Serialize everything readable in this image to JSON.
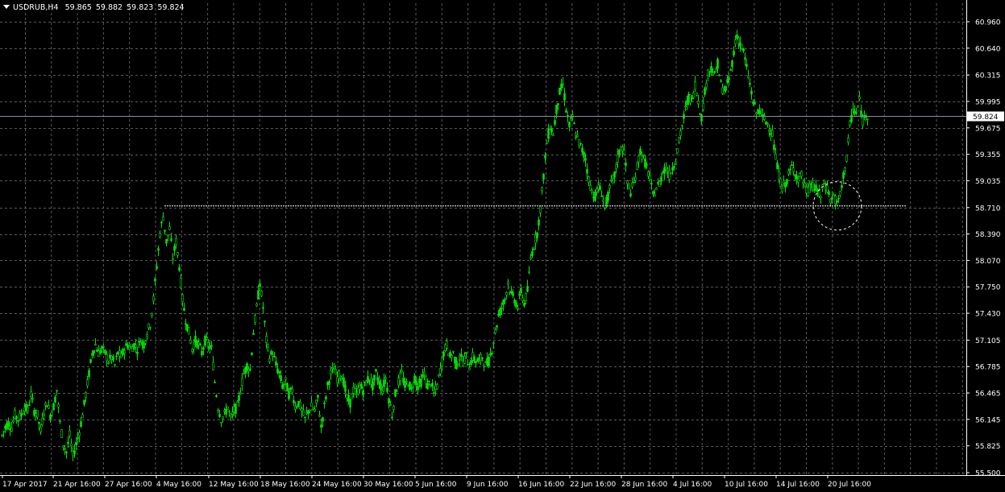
{
  "header": {
    "symbol_timeframe": "USDRUB,H4",
    "open": "59.865",
    "high": "59.882",
    "low": "59.823",
    "close": "59.824"
  },
  "current_price_label": "59.824",
  "colors": {
    "background": "#000000",
    "grid": "#5a5a5a",
    "candle": "#00e600",
    "text": "#ffffff",
    "price_line": "#8a8aa0",
    "level_line": "#ffffff"
  },
  "chart_data": {
    "type": "candlestick",
    "symbol": "USDRUB",
    "timeframe": "H4",
    "y_ticks": [
      "60.960",
      "60.640",
      "60.315",
      "59.995",
      "59.675",
      "59.355",
      "59.035",
      "58.710",
      "58.390",
      "58.070",
      "57.750",
      "57.430",
      "57.105",
      "56.785",
      "56.465",
      "56.145",
      "55.825",
      "55.500"
    ],
    "x_ticks": [
      "17 Apr 2017",
      "21 Apr 16:00",
      "27 Apr 16:00",
      "4 May 16:00",
      "12 May 16:00",
      "18 May 16:00",
      "24 May 16:00",
      "30 May 16:00",
      "5 Jun 16:00",
      "9 Jun 16:00",
      "16 Jun 16:00",
      "22 Jun 16:00",
      "28 Jun 16:00",
      "4 Jul 16:00",
      "10 Jul 16:00",
      "14 Jul 16:00",
      "20 Jul 16:00"
    ],
    "ylim": [
      55.5,
      60.96
    ],
    "grid": true,
    "price_path": [
      [
        0,
        55.95
      ],
      [
        4,
        56.05
      ],
      [
        8,
        56.1
      ],
      [
        12,
        56.05
      ],
      [
        16,
        56.2
      ],
      [
        20,
        56.15
      ],
      [
        24,
        56.2
      ],
      [
        28,
        56.3
      ],
      [
        32,
        56.25
      ],
      [
        36,
        56.45
      ],
      [
        40,
        56.25
      ],
      [
        44,
        56.2
      ],
      [
        48,
        56.0
      ],
      [
        52,
        56.25
      ],
      [
        56,
        56.35
      ],
      [
        60,
        56.2
      ],
      [
        64,
        56.3
      ],
      [
        68,
        56.5
      ],
      [
        72,
        56.1
      ],
      [
        76,
        55.85
      ],
      [
        80,
        55.75
      ],
      [
        84,
        55.95
      ],
      [
        88,
        55.7
      ],
      [
        92,
        55.85
      ],
      [
        96,
        56.0
      ],
      [
        100,
        56.2
      ],
      [
        104,
        56.45
      ],
      [
        108,
        56.7
      ],
      [
        112,
        56.95
      ],
      [
        116,
        57.05
      ],
      [
        120,
        56.95
      ],
      [
        124,
        57.0
      ],
      [
        128,
        56.95
      ],
      [
        132,
        56.85
      ],
      [
        136,
        56.9
      ],
      [
        140,
        56.8
      ],
      [
        144,
        56.95
      ],
      [
        148,
        56.9
      ],
      [
        152,
        57.0
      ],
      [
        156,
        57.05
      ],
      [
        160,
        57.0
      ],
      [
        164,
        57.05
      ],
      [
        168,
        57.0
      ],
      [
        172,
        57.1
      ],
      [
        176,
        57.05
      ],
      [
        180,
        57.2
      ],
      [
        184,
        57.3
      ],
      [
        188,
        57.6
      ],
      [
        192,
        58.0
      ],
      [
        196,
        58.4
      ],
      [
        200,
        58.6
      ],
      [
        204,
        58.3
      ],
      [
        208,
        58.45
      ],
      [
        212,
        58.1
      ],
      [
        216,
        58.3
      ],
      [
        220,
        58.0
      ],
      [
        224,
        57.6
      ],
      [
        228,
        57.35
      ],
      [
        232,
        57.2
      ],
      [
        236,
        57.0
      ],
      [
        240,
        57.1
      ],
      [
        244,
        57.05
      ],
      [
        248,
        56.95
      ],
      [
        252,
        57.1
      ],
      [
        256,
        57.05
      ],
      [
        260,
        57.0
      ],
      [
        264,
        56.6
      ],
      [
        268,
        56.3
      ],
      [
        272,
        56.15
      ],
      [
        276,
        56.2
      ],
      [
        280,
        56.3
      ],
      [
        284,
        56.15
      ],
      [
        288,
        56.25
      ],
      [
        292,
        56.3
      ],
      [
        296,
        56.5
      ],
      [
        300,
        56.7
      ],
      [
        304,
        56.8
      ],
      [
        308,
        56.75
      ],
      [
        312,
        57.2
      ],
      [
        316,
        57.5
      ],
      [
        320,
        57.8
      ],
      [
        324,
        57.5
      ],
      [
        328,
        57.1
      ],
      [
        332,
        56.9
      ],
      [
        336,
        56.95
      ],
      [
        340,
        56.8
      ],
      [
        344,
        56.7
      ],
      [
        348,
        56.55
      ],
      [
        352,
        56.6
      ],
      [
        356,
        56.45
      ],
      [
        360,
        56.5
      ],
      [
        364,
        56.3
      ],
      [
        368,
        56.35
      ],
      [
        372,
        56.25
      ],
      [
        376,
        56.15
      ],
      [
        380,
        56.25
      ],
      [
        384,
        56.3
      ],
      [
        388,
        56.25
      ],
      [
        392,
        56.4
      ],
      [
        396,
        56.05
      ],
      [
        400,
        56.3
      ],
      [
        404,
        56.55
      ],
      [
        408,
        56.7
      ],
      [
        412,
        56.75
      ],
      [
        416,
        56.65
      ],
      [
        420,
        56.7
      ],
      [
        424,
        56.6
      ],
      [
        428,
        56.4
      ],
      [
        432,
        56.35
      ],
      [
        436,
        56.5
      ],
      [
        440,
        56.45
      ],
      [
        444,
        56.55
      ],
      [
        448,
        56.5
      ],
      [
        452,
        56.6
      ],
      [
        456,
        56.65
      ],
      [
        460,
        56.55
      ],
      [
        464,
        56.7
      ],
      [
        468,
        56.6
      ],
      [
        472,
        56.5
      ],
      [
        476,
        56.65
      ],
      [
        480,
        56.4
      ],
      [
        484,
        56.2
      ],
      [
        488,
        56.45
      ],
      [
        492,
        56.6
      ],
      [
        496,
        56.7
      ],
      [
        500,
        56.55
      ],
      [
        504,
        56.6
      ],
      [
        508,
        56.5
      ],
      [
        512,
        56.65
      ],
      [
        516,
        56.55
      ],
      [
        520,
        56.6
      ],
      [
        524,
        56.7
      ],
      [
        528,
        56.55
      ],
      [
        532,
        56.6
      ],
      [
        536,
        56.45
      ],
      [
        540,
        56.55
      ],
      [
        544,
        56.75
      ],
      [
        548,
        56.95
      ],
      [
        552,
        57.05
      ],
      [
        556,
        56.9
      ],
      [
        560,
        56.95
      ],
      [
        564,
        56.8
      ],
      [
        568,
        56.9
      ],
      [
        572,
        56.85
      ],
      [
        576,
        56.9
      ],
      [
        580,
        56.8
      ],
      [
        584,
        56.9
      ],
      [
        588,
        56.85
      ],
      [
        592,
        56.85
      ],
      [
        596,
        56.9
      ],
      [
        600,
        56.8
      ],
      [
        604,
        56.85
      ],
      [
        608,
        57.0
      ],
      [
        612,
        57.2
      ],
      [
        616,
        57.4
      ],
      [
        620,
        57.5
      ],
      [
        624,
        57.6
      ],
      [
        628,
        57.8
      ],
      [
        632,
        57.65
      ],
      [
        636,
        57.6
      ],
      [
        640,
        57.5
      ],
      [
        644,
        57.7
      ],
      [
        648,
        57.55
      ],
      [
        652,
        57.7
      ],
      [
        656,
        58.1
      ],
      [
        660,
        58.25
      ],
      [
        664,
        58.4
      ],
      [
        668,
        58.7
      ],
      [
        672,
        59.1
      ],
      [
        676,
        59.5
      ],
      [
        680,
        59.7
      ],
      [
        684,
        59.6
      ],
      [
        688,
        59.9
      ],
      [
        692,
        60.1
      ],
      [
        696,
        60.2
      ],
      [
        700,
        59.9
      ],
      [
        704,
        59.7
      ],
      [
        708,
        59.8
      ],
      [
        712,
        59.6
      ],
      [
        716,
        59.5
      ],
      [
        720,
        59.4
      ],
      [
        724,
        59.3
      ],
      [
        728,
        59.05
      ],
      [
        732,
        58.9
      ],
      [
        736,
        58.85
      ],
      [
        740,
        58.95
      ],
      [
        744,
        58.9
      ],
      [
        748,
        58.7
      ],
      [
        752,
        58.85
      ],
      [
        756,
        59.0
      ],
      [
        760,
        59.1
      ],
      [
        764,
        59.3
      ],
      [
        768,
        59.45
      ],
      [
        772,
        59.4
      ],
      [
        776,
        59.0
      ],
      [
        780,
        58.9
      ],
      [
        784,
        59.0
      ],
      [
        788,
        59.2
      ],
      [
        792,
        59.4
      ],
      [
        796,
        59.3
      ],
      [
        800,
        59.2
      ],
      [
        804,
        59.05
      ],
      [
        808,
        58.85
      ],
      [
        812,
        58.95
      ],
      [
        816,
        59.0
      ],
      [
        820,
        59.15
      ],
      [
        824,
        59.2
      ],
      [
        828,
        59.1
      ],
      [
        832,
        59.2
      ],
      [
        836,
        59.3
      ],
      [
        840,
        59.5
      ],
      [
        844,
        59.7
      ],
      [
        848,
        59.9
      ],
      [
        852,
        60.05
      ],
      [
        856,
        60.0
      ],
      [
        860,
        60.2
      ],
      [
        864,
        60.0
      ],
      [
        868,
        59.8
      ],
      [
        872,
        60.1
      ],
      [
        876,
        60.35
      ],
      [
        880,
        60.4
      ],
      [
        884,
        60.3
      ],
      [
        888,
        60.45
      ],
      [
        892,
        60.2
      ],
      [
        896,
        60.1
      ],
      [
        900,
        60.2
      ],
      [
        904,
        60.35
      ],
      [
        908,
        60.6
      ],
      [
        912,
        60.8
      ],
      [
        916,
        60.7
      ],
      [
        920,
        60.6
      ],
      [
        924,
        60.4
      ],
      [
        928,
        60.2
      ],
      [
        932,
        60.0
      ],
      [
        936,
        59.85
      ],
      [
        940,
        59.9
      ],
      [
        944,
        59.8
      ],
      [
        948,
        59.75
      ],
      [
        952,
        59.7
      ],
      [
        956,
        59.6
      ],
      [
        960,
        59.3
      ],
      [
        964,
        59.1
      ],
      [
        968,
        58.95
      ],
      [
        972,
        59.0
      ],
      [
        976,
        59.1
      ],
      [
        980,
        59.2
      ],
      [
        984,
        59.15
      ],
      [
        988,
        59.05
      ],
      [
        992,
        59.1
      ],
      [
        996,
        58.95
      ],
      [
        1000,
        58.9
      ],
      [
        1004,
        59.0
      ],
      [
        1008,
        58.95
      ],
      [
        1012,
        58.9
      ],
      [
        1016,
        58.85
      ],
      [
        1020,
        59.0
      ],
      [
        1024,
        58.95
      ],
      [
        1028,
        58.8
      ],
      [
        1032,
        58.85
      ],
      [
        1036,
        58.75
      ],
      [
        1040,
        58.85
      ],
      [
        1044,
        59.1
      ],
      [
        1048,
        59.3
      ],
      [
        1052,
        59.7
      ],
      [
        1056,
        59.9
      ],
      [
        1060,
        59.85
      ],
      [
        1064,
        60.0
      ],
      [
        1068,
        59.75
      ],
      [
        1072,
        59.85
      ],
      [
        1076,
        59.82
      ]
    ],
    "current_price": 59.824,
    "level_line": 58.73
  }
}
